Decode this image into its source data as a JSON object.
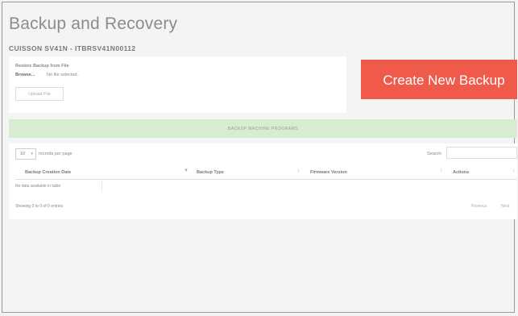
{
  "page": {
    "title": "Backup and Recovery",
    "subtitle": "CUISSON SV41N - ITBRSV41N00112"
  },
  "restore": {
    "label": "Restore Backup from File",
    "browse_label": "Browse...",
    "no_file_label": "No file selected.",
    "upload_label": "Upload File"
  },
  "create_backup_label": "Create New Backup",
  "progress": {
    "label": "BACKUP MACHINE PROGRAMS"
  },
  "table": {
    "length_value": "10",
    "records_per_page_label": "records per page",
    "search_label": "Search:",
    "columns": [
      "Backup Creation Date",
      "Backup Type",
      "Firmware Version",
      "Actions"
    ],
    "empty_text": "No data available in table",
    "info_text": "Showing 0 to 0 of 0 entries",
    "prev_label": "Previous",
    "next_label": "Next"
  },
  "icons": {
    "sort": "sort-icon",
    "caret": "caret-icon"
  },
  "colors": {
    "accent": "#ef5a4a",
    "progress_bg": "#d8ecd2"
  }
}
